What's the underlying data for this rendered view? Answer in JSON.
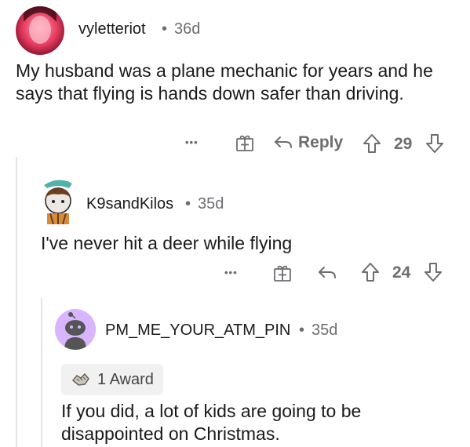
{
  "comments": [
    {
      "username": "vyletteriot",
      "separator": "•",
      "age": "36d",
      "body": "My husband was a plane mechanic for years and he says that flying is hands down safer than driving.",
      "actions": {
        "more": "•••",
        "reply": "Reply",
        "score": "29"
      }
    },
    {
      "username": "K9sandKilos",
      "separator": "•",
      "age": "35d",
      "body": "I've never hit a deer while flying",
      "actions": {
        "more": "•••",
        "score": "24"
      }
    },
    {
      "username": "PM_ME_YOUR_ATM_PIN",
      "separator": "•",
      "age": "35d",
      "award": "1 Award",
      "body": "If you did, a lot of kids are going to be disappointed on Christmas."
    }
  ],
  "colors": {
    "thread_line": "#e6e6e6",
    "avatar2_bg": "#ece7e4",
    "avatar3_bg": "#d7b6ff"
  }
}
